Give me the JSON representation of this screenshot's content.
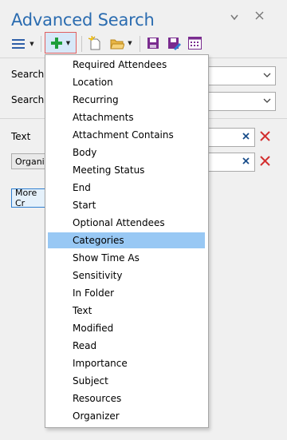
{
  "panel": {
    "title": "Advanced Search"
  },
  "pane_controls": {
    "dropdown_icon": "chevron-down-icon",
    "close_icon": "close-icon"
  },
  "toolbar": {
    "icons": [
      "hamburger-icon",
      "add-icon",
      "new-search-icon",
      "open-folder-icon",
      "save-icon",
      "edit-icon",
      "grid-icon"
    ]
  },
  "form": {
    "search_items_label": "Search it",
    "search_scope_label": "Search s",
    "text_label": "Text",
    "organizer_label": "Organiz",
    "more_button": "More Cr"
  },
  "menu": {
    "items": [
      "Required Attendees",
      "Location",
      "Recurring",
      "Attachments",
      "Attachment Contains",
      "Body",
      "Meeting Status",
      "End",
      "Start",
      "Optional Attendees",
      "Categories",
      "Show Time As",
      "Sensitivity",
      "In Folder",
      "Text",
      "Modified",
      "Read",
      "Importance",
      "Subject",
      "Resources",
      "Organizer"
    ],
    "selected": "Categories"
  },
  "colors": {
    "title": "#2b6cb0",
    "selection": "#98c8f4",
    "add_icon": "#1e9e3a",
    "remove_icon": "#d32f2f"
  }
}
